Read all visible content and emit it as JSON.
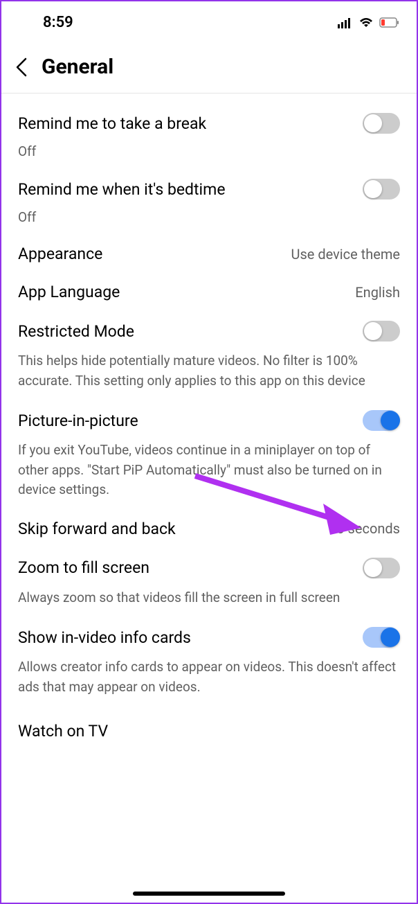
{
  "statusBar": {
    "time": "8:59"
  },
  "header": {
    "title": "General"
  },
  "settings": {
    "break": {
      "title": "Remind me to take a break",
      "subtitle": "Off"
    },
    "bedtime": {
      "title": "Remind me when it's bedtime",
      "subtitle": "Off"
    },
    "appearance": {
      "title": "Appearance",
      "value": "Use device theme"
    },
    "language": {
      "title": "App Language",
      "value": "English"
    },
    "restricted": {
      "title": "Restricted Mode",
      "desc": "This helps hide potentially mature videos. No filter is 100% accurate. This setting only applies to this app on this device"
    },
    "pip": {
      "title": "Picture-in-picture",
      "desc": "If you exit YouTube, videos continue in a miniplayer on top of other apps. \"Start PiP Automatically\" must also be turned on in device settings."
    },
    "skip": {
      "title": "Skip forward and back",
      "value": "10 seconds"
    },
    "zoom": {
      "title": "Zoom to fill screen",
      "desc": "Always zoom so that videos fill the screen in full screen"
    },
    "infoCards": {
      "title": "Show in-video info cards",
      "desc": "Allows creator info cards to appear on videos. This doesn't affect ads that may appear on videos."
    },
    "watchTv": {
      "title": "Watch on TV"
    }
  }
}
